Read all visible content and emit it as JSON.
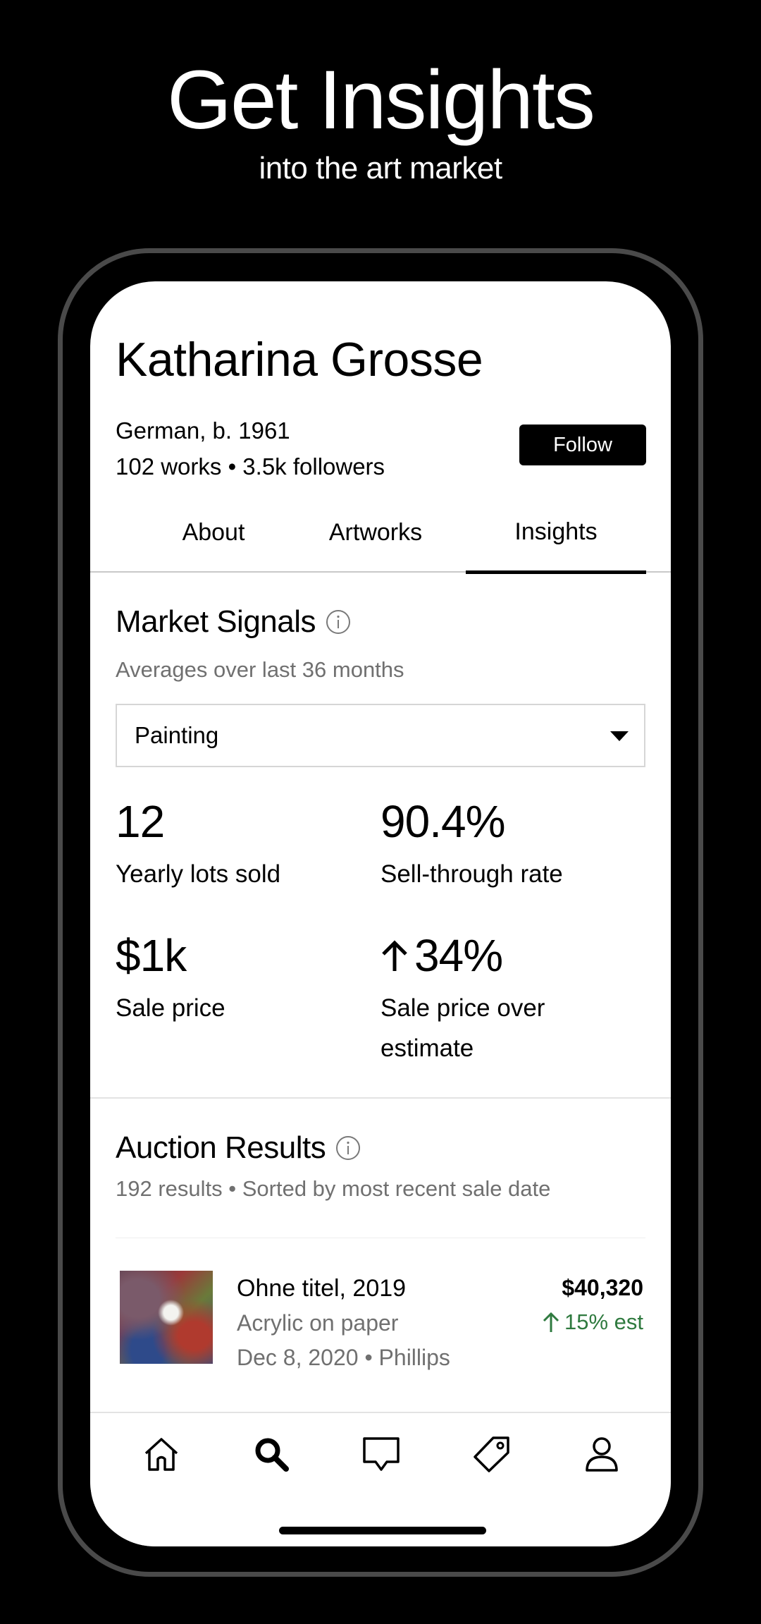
{
  "promo": {
    "title": "Get Insights",
    "subtitle": "into the art market"
  },
  "artist": {
    "name": "Katharina Grosse",
    "nationality": "German, b. 1961",
    "stats": "102 works • 3.5k followers",
    "follow_label": "Follow"
  },
  "tabs": [
    {
      "label": "About",
      "active": false
    },
    {
      "label": "Artworks",
      "active": false
    },
    {
      "label": "Insights",
      "active": true
    }
  ],
  "market_signals": {
    "title": "Market Signals",
    "subtitle": "Averages over last 36 months",
    "filter_selected": "Painting",
    "stats": [
      {
        "value": "12",
        "label": "Yearly lots sold"
      },
      {
        "value": "90.4%",
        "label": "Sell-through rate"
      },
      {
        "value": "$1k",
        "label": "Sale price"
      },
      {
        "value": "34%",
        "label_line1": "Sale price over",
        "label_line2": "estimate",
        "trend": "up"
      }
    ]
  },
  "auction_results": {
    "title": "Auction Results",
    "subtitle": "192 results • Sorted by most recent sale date",
    "items": [
      {
        "title": "Ohne titel, 2019",
        "medium": "Acrylic on paper",
        "date_house": "Dec 8, 2020 • Phillips",
        "price": "$40,320",
        "estimate_delta": "15% est",
        "trend": "up"
      }
    ]
  },
  "bottom_nav": [
    {
      "icon": "home-icon",
      "active": false
    },
    {
      "icon": "search-icon",
      "active": true
    },
    {
      "icon": "inbox-icon",
      "active": false
    },
    {
      "icon": "tag-icon",
      "active": false
    },
    {
      "icon": "profile-icon",
      "active": false
    }
  ],
  "colors": {
    "background": "#000000",
    "screen": "#ffffff",
    "accent_positive": "#2f7a3f",
    "secondary_text": "#707070"
  }
}
